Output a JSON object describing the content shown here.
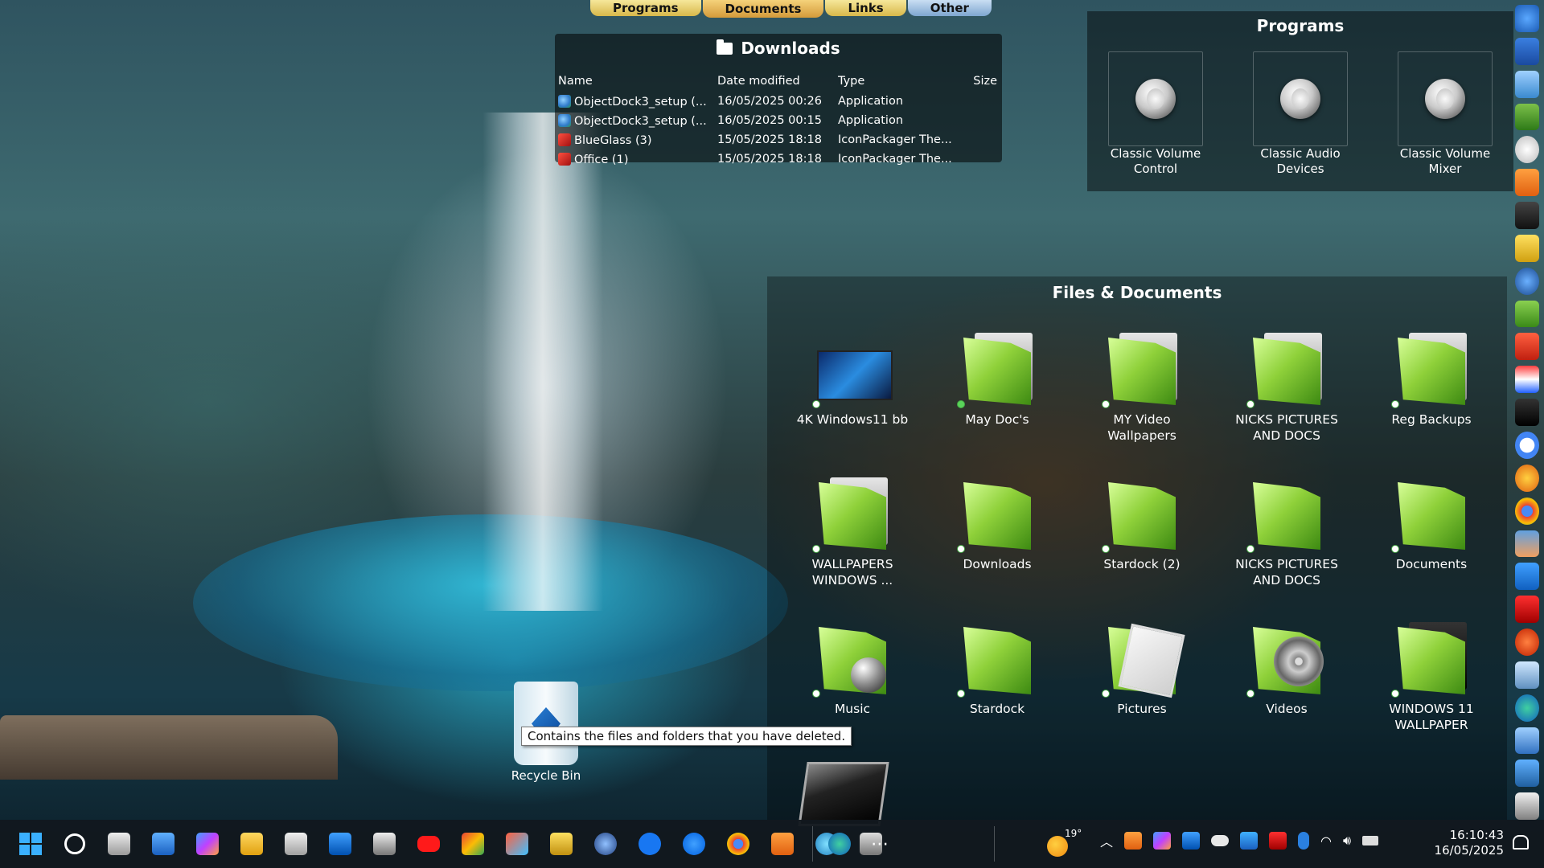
{
  "tabs": [
    {
      "label": "Programs"
    },
    {
      "label": "Documents"
    },
    {
      "label": "Links"
    },
    {
      "label": "Other"
    }
  ],
  "downloads": {
    "title": "Downloads",
    "columns": {
      "name": "Name",
      "date": "Date modified",
      "type": "Type",
      "size": "Size"
    },
    "rows": [
      {
        "name": "ObjectDock3_setup (...",
        "date": "16/05/2025 00:26",
        "type": "Application",
        "icon": "app-icon"
      },
      {
        "name": "ObjectDock3_setup (...",
        "date": "16/05/2025 00:15",
        "type": "Application",
        "icon": "app-icon"
      },
      {
        "name": "BlueGlass (3)",
        "date": "15/05/2025 18:18",
        "type": "IconPackager The...",
        "icon": "theme-icon"
      },
      {
        "name": "Office (1)",
        "date": "15/05/2025 18:18",
        "type": "IconPackager The...",
        "icon": "theme-icon"
      }
    ]
  },
  "programs": {
    "title": "Programs",
    "items": [
      {
        "label": "Classic Volume Control"
      },
      {
        "label": "Classic Audio Devices"
      },
      {
        "label": "Classic Volume Mixer"
      }
    ]
  },
  "files": {
    "title": "Files & Documents",
    "items": [
      {
        "label": "4K Windows11 bb",
        "icon": "screenshot-icon"
      },
      {
        "label": "May Doc's",
        "icon": "folder-icon"
      },
      {
        "label": "MY Video Wallpapers",
        "icon": "folder-icon"
      },
      {
        "label": "NICKS PICTURES AND DOCS",
        "icon": "folder-icon"
      },
      {
        "label": "Reg Backups",
        "icon": "folder-icon"
      },
      {
        "label": "WALLPAPERS WINDOWS ...",
        "icon": "folder-icon"
      },
      {
        "label": "Downloads",
        "icon": "downloads-folder-icon"
      },
      {
        "label": "Stardock (2)",
        "icon": "folder-icon"
      },
      {
        "label": "NICKS PICTURES AND DOCS",
        "icon": "folder-icon"
      },
      {
        "label": "Documents",
        "icon": "documents-folder-icon"
      },
      {
        "label": "Music",
        "icon": "music-folder-icon"
      },
      {
        "label": "Stardock",
        "icon": "folder-icon"
      },
      {
        "label": "Pictures",
        "icon": "pictures-folder-icon"
      },
      {
        "label": "Videos",
        "icon": "videos-folder-icon"
      },
      {
        "label": "WINDOWS 11 WALLPAPER",
        "icon": "folder-icon"
      }
    ]
  },
  "desktop": {
    "recycle_bin_label": "Recycle Bin",
    "tooltip": "Contains the files and folders that you have deleted."
  },
  "taskbar": {
    "weather_temp": "19°",
    "time": "16:10:43",
    "date": "16/05/2025"
  }
}
